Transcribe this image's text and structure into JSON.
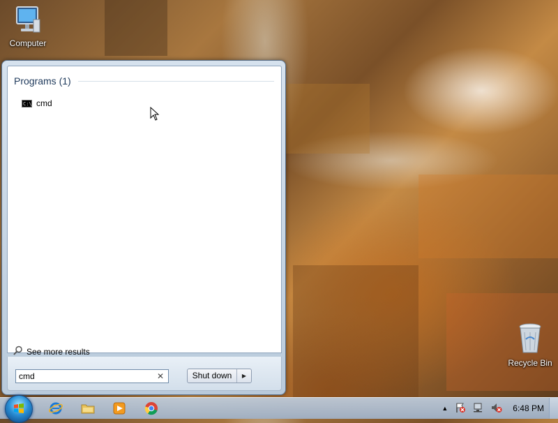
{
  "desktop": {
    "icons": [
      {
        "label": "Computer",
        "icon": "computer-icon"
      },
      {
        "label": "Recycle Bin",
        "icon": "recycle-bin-icon"
      }
    ]
  },
  "start_menu": {
    "group_header": "Programs (1)",
    "programs": [
      {
        "label": "cmd",
        "icon": "cmd-icon"
      }
    ],
    "see_more": "See more results",
    "search": {
      "value": "cmd",
      "clear_icon": "clear-icon"
    },
    "shutdown_label": "Shut down"
  },
  "taskbar": {
    "pinned": [
      "internet-explorer-icon",
      "folder-icon",
      "media-player-icon",
      "chrome-icon"
    ],
    "tray_icons": [
      "show-hidden-icons-arrow",
      "action-center-flag-icon",
      "network-icon",
      "volume-muted-icon"
    ],
    "clock": "6:48 PM"
  },
  "colors": {
    "group_header_text": "#1e395b",
    "menu_bg": "#d6e2ee"
  }
}
